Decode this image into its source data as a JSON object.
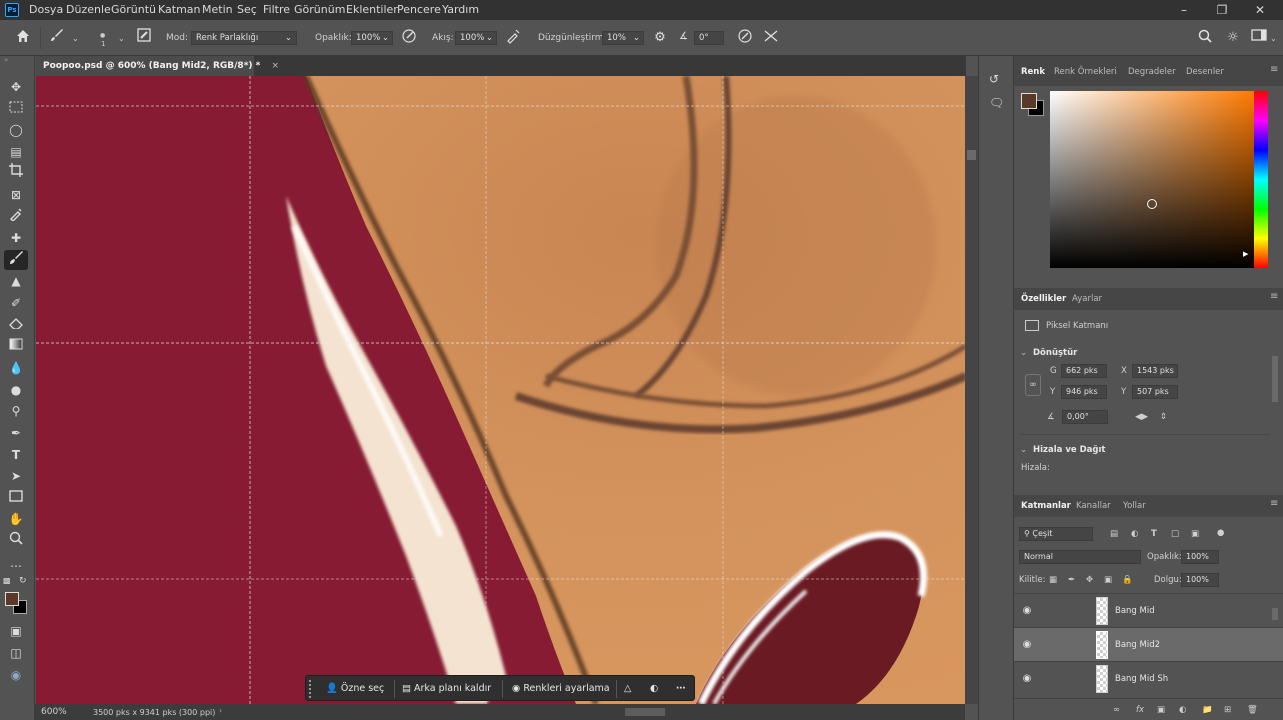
{
  "menubar": {
    "logo": "Ps",
    "items": [
      "Dosya",
      "Düzenle",
      "Görüntü",
      "Katman",
      "Metin",
      "Seç",
      "Filtre",
      "Görünüm",
      "Eklentiler",
      "Pencere",
      "Yardım"
    ],
    "window_controls": [
      "minimize-icon",
      "restore-icon",
      "close-icon"
    ]
  },
  "options": {
    "brush_size": "1",
    "mode_label": "Mod:",
    "mode_value": "Renk Parlaklığı",
    "opacity_label": "Opaklık:",
    "opacity_value": "100%",
    "flow_label": "Akış:",
    "flow_value": "100%",
    "smoothing_label": "Düzgünleştirme:",
    "smoothing_value": "10%",
    "angle_value": "0°"
  },
  "document": {
    "tab_title": "Poopoo.psd @ 600% (Bang Mid2, RGB/8*) *",
    "zoom": "600%",
    "doc_info": "3500 pks x 9341 pks (300 ppi)"
  },
  "contextbar": {
    "select_subject": "Özne seç",
    "remove_bg": "Arka planı kaldır",
    "adjust_colors": "Renkleri ayarlama"
  },
  "color_panel": {
    "tabs": [
      "Renk",
      "Renk Örnekleri",
      "Degradeler",
      "Desenler"
    ],
    "foreground": "#5a3a26",
    "background": "#000000",
    "hue_color": "#ff7a00"
  },
  "properties": {
    "tabs": [
      "Özellikler",
      "Ayarlar"
    ],
    "layer_type": "Piksel Katmanı",
    "transform_title": "Dönüştür",
    "w_label": "G",
    "w_value": "662 pks",
    "x_label": "X",
    "x_value": "1543 pks",
    "h_label": "Y",
    "h_value": "946 pks",
    "y_label": "Y",
    "y_value": "507 pks",
    "angle_value": "0,00°",
    "align_title": "Hizala ve Dağıt",
    "align_label": "Hizala:"
  },
  "layers": {
    "tabs": [
      "Katmanlar",
      "Kanallar",
      "Yollar"
    ],
    "filter_kind": "Çeşit",
    "blend_mode": "Normal",
    "opacity_label": "Opaklık:",
    "opacity_value": "100%",
    "lock_label": "Kilitle:",
    "fill_label": "Dolgu:",
    "fill_value": "100%",
    "items": [
      {
        "name": "Bang Mid",
        "selected": false
      },
      {
        "name": "Bang Mid2",
        "selected": true
      },
      {
        "name": "Bang Mid Sh",
        "selected": false
      }
    ]
  }
}
